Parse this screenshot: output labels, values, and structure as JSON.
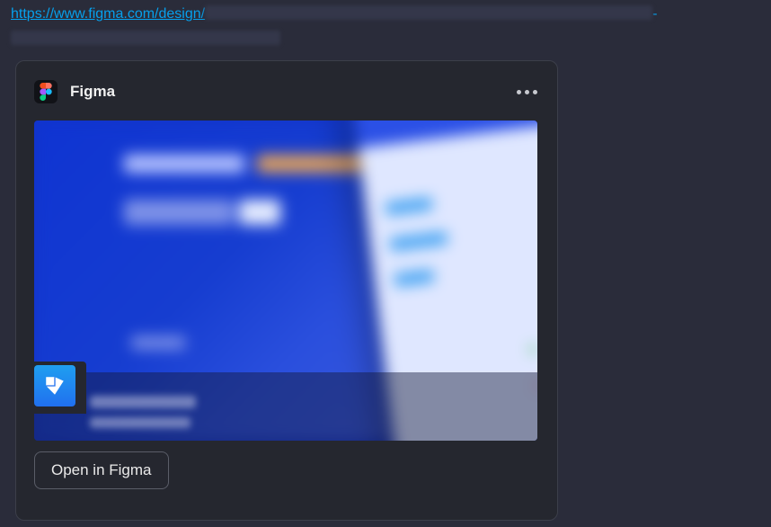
{
  "link": {
    "visible_url": "https://www.figma.com/design/"
  },
  "card": {
    "provider": "Figma",
    "open_button_label": "Open in Figma"
  }
}
